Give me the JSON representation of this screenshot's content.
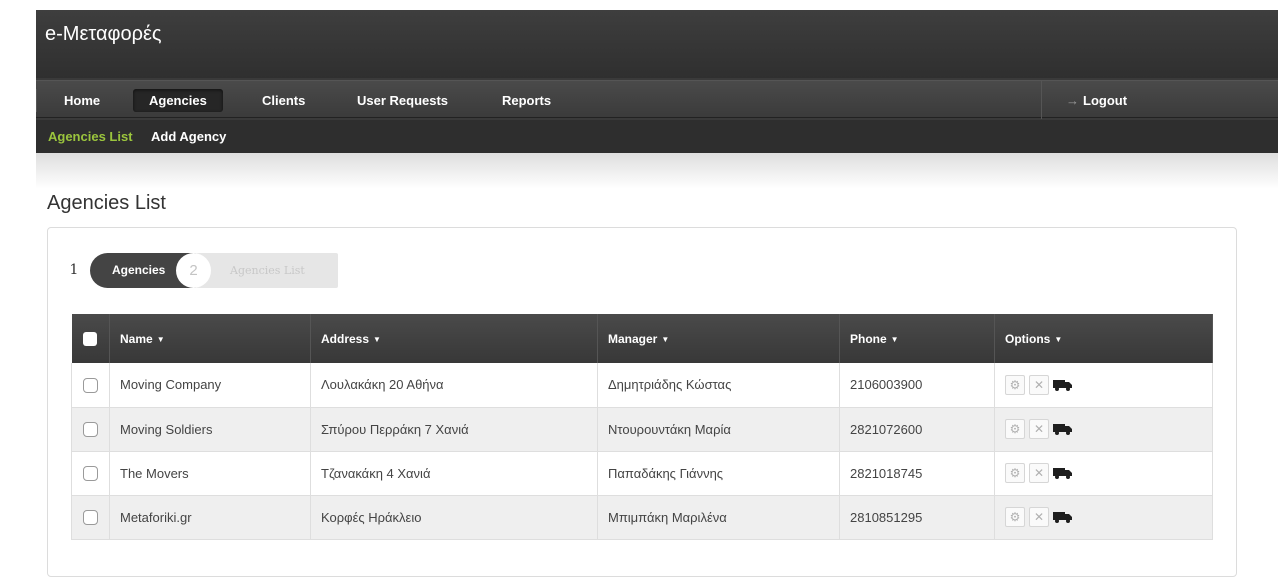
{
  "app": {
    "title": "e-Μεταφορές"
  },
  "nav": {
    "items": [
      {
        "label": "Home"
      },
      {
        "label": "Agencies"
      },
      {
        "label": "Clients"
      },
      {
        "label": "User Requests"
      },
      {
        "label": "Reports"
      }
    ],
    "active": "Agencies",
    "logout_label": "Logout"
  },
  "subnav": {
    "items": [
      {
        "label": "Agencies List"
      },
      {
        "label": "Add Agency"
      }
    ],
    "current": "Agencies List",
    "current_color": "#9bc53d"
  },
  "page": {
    "title": "Agencies List"
  },
  "wizard": {
    "step1_number": "1",
    "step1_label": "Agencies",
    "step2_number": "2",
    "step2_label": "Agencies List"
  },
  "table": {
    "columns": [
      {
        "label": "Name"
      },
      {
        "label": "Address"
      },
      {
        "label": "Manager"
      },
      {
        "label": "Phone"
      },
      {
        "label": "Options"
      }
    ],
    "rows": [
      {
        "name": "Moving Company",
        "address": "Λουλακάκη 20 Αθήνα",
        "manager": "Δημητριάδης Κώστας",
        "phone": "2106003900"
      },
      {
        "name": "Moving Soldiers",
        "address": "Σπύρου Περράκη 7 Χανιά",
        "manager": "Ντουρουντάκη Μαρία",
        "phone": "2821072600"
      },
      {
        "name": "The Movers",
        "address": "Τζανακάκη 4 Χανιά",
        "manager": "Παπαδάκης Γιάννης",
        "phone": "2821018745"
      },
      {
        "name": "Metaforiki.gr",
        "address": "Κορφές Ηράκλειο",
        "manager": "Μπιμπάκη Μαριλένα",
        "phone": "2810851295"
      }
    ],
    "row_actions": [
      "gear-icon",
      "close-icon",
      "truck-icon"
    ]
  }
}
